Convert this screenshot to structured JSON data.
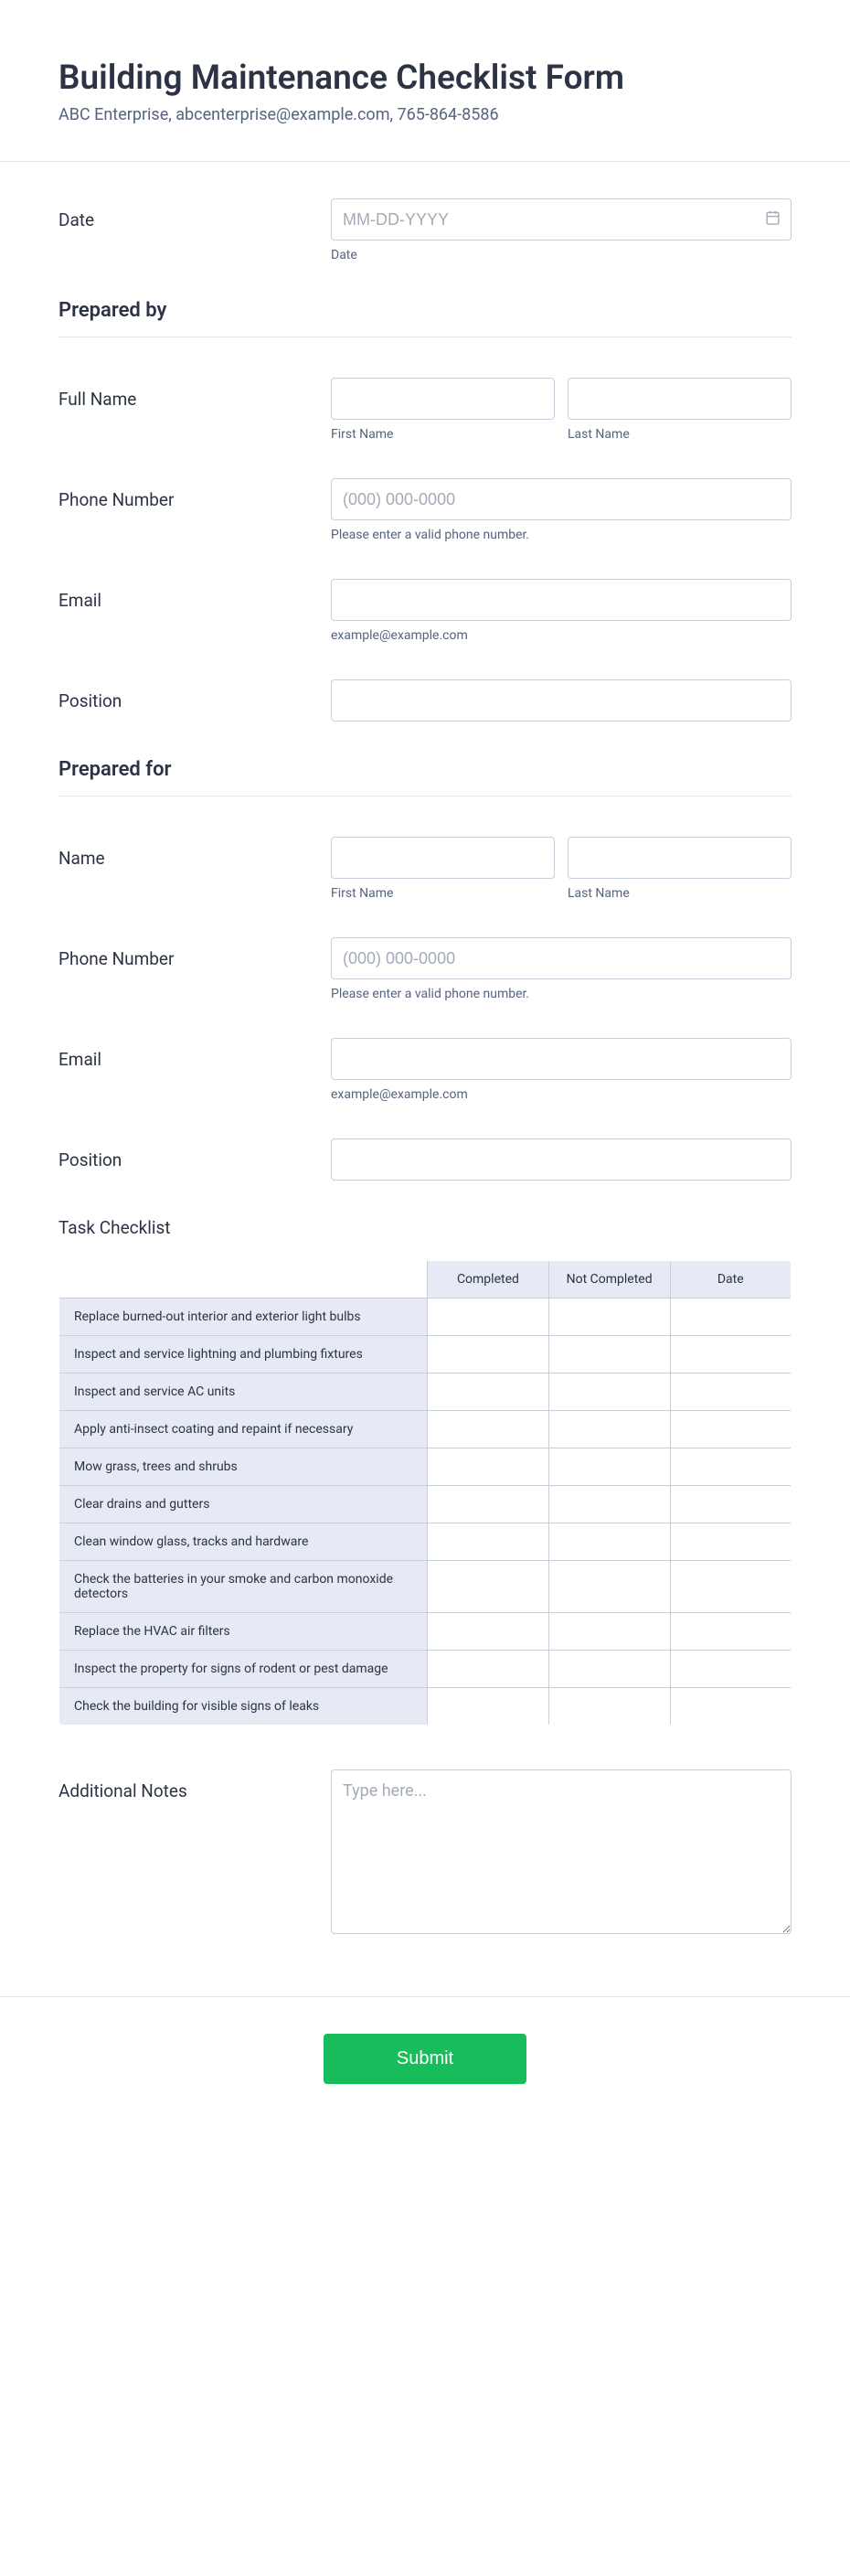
{
  "header": {
    "title": "Building Maintenance Checklist Form",
    "subtitle": "ABC Enterprise, abcenterprise@example.com, 765-864-8586"
  },
  "date": {
    "label": "Date",
    "placeholder": "MM-DD-YYYY",
    "sublabel": "Date"
  },
  "prepared_by": {
    "heading": "Prepared by",
    "full_name": {
      "label": "Full Name",
      "first_sublabel": "First Name",
      "last_sublabel": "Last Name"
    },
    "phone": {
      "label": "Phone Number",
      "placeholder": "(000) 000-0000",
      "sublabel": "Please enter a valid phone number."
    },
    "email": {
      "label": "Email",
      "sublabel": "example@example.com"
    },
    "position": {
      "label": "Position"
    }
  },
  "prepared_for": {
    "heading": "Prepared for",
    "name": {
      "label": "Name",
      "first_sublabel": "First Name",
      "last_sublabel": "Last Name"
    },
    "phone": {
      "label": "Phone Number",
      "placeholder": "(000) 000-0000",
      "sublabel": "Please enter a valid phone number."
    },
    "email": {
      "label": "Email",
      "sublabel": "example@example.com"
    },
    "position": {
      "label": "Position"
    }
  },
  "checklist": {
    "heading": "Task Checklist",
    "columns": [
      "Completed",
      "Not Completed",
      "Date"
    ],
    "tasks": [
      "Replace burned-out interior and exterior light bulbs",
      "Inspect and service lightning and plumbing fixtures",
      "Inspect and service AC units",
      "Apply anti-insect coating and repaint if necessary",
      "Mow grass, trees and shrubs",
      "Clear drains and gutters",
      "Clean window glass, tracks and hardware",
      "Check the batteries in your smoke and carbon monoxide detectors",
      "Replace the HVAC air filters",
      "Inspect the property for signs of rodent or pest damage",
      "Check the building for visible signs of leaks"
    ]
  },
  "notes": {
    "label": "Additional Notes",
    "placeholder": "Type here..."
  },
  "submit": {
    "label": "Submit"
  }
}
